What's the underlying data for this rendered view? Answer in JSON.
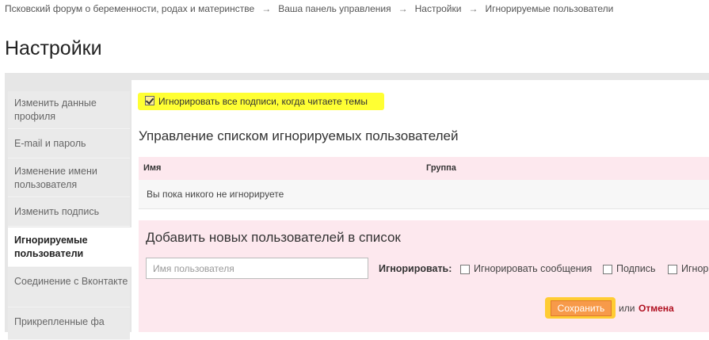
{
  "breadcrumb": {
    "items": [
      "Псковский форум о беременности, родах и материнстве",
      "Ваша панель управления",
      "Настройки",
      "Игнорируемые пользователи"
    ],
    "separator": "→"
  },
  "page_title": "Настройки",
  "sidebar": {
    "items": [
      {
        "label": "Изменить данные профиля",
        "active": false
      },
      {
        "label": "E-mail и пароль",
        "active": false
      },
      {
        "label": "Изменение имени пользователя",
        "active": false
      },
      {
        "label": "Изменить подпись",
        "active": false
      },
      {
        "label": "Игнорируемые пользователи",
        "active": true
      },
      {
        "label": "Соединение с Вконтакте",
        "active": false
      },
      {
        "label": "Прикрепленные фа",
        "active": false
      }
    ]
  },
  "main": {
    "ignore_signatures": {
      "label": "Игнорировать все подписи, когда читаете темы",
      "checked": true
    },
    "manage_title": "Управление списком игнорируемых пользователей",
    "table": {
      "columns": [
        "Имя",
        "Группа"
      ],
      "empty_text": "Вы пока никого не игнорируете"
    },
    "add": {
      "title": "Добавить новых пользователей в список",
      "username_placeholder": "Имя пользователя",
      "ignore_label": "Игнорировать:",
      "options": [
        {
          "label": "Игнорировать сообщения",
          "checked": false
        },
        {
          "label": "Подпись",
          "checked": false
        },
        {
          "label": "Игнор",
          "checked": false
        }
      ],
      "save_label": "Сохранить",
      "or_text": "или",
      "cancel_label": "Отмена"
    }
  },
  "colors": {
    "highlight": "#ffff33",
    "table_header": "#fde8ee",
    "save_button": "#f79a4a",
    "cancel": "#b01020"
  }
}
